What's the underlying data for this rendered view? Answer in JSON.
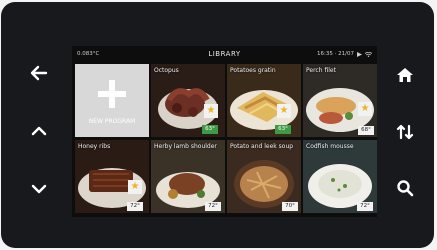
{
  "status": {
    "left": "0.083°C",
    "title": "LIBRARY",
    "right": "16:35 · 21/07"
  },
  "new_program": {
    "label": "NEW PROGRAM"
  },
  "tiles": [
    {
      "label": "Octopus",
      "temp": "63°",
      "icon": "star-icon"
    },
    {
      "label": "Potatoes gratin",
      "temp": "63°",
      "icon": "star-icon"
    },
    {
      "label": "Perch filet",
      "temp": "68°",
      "icon": "star-icon"
    },
    {
      "label": "Honey ribs",
      "temp": "72°",
      "icon": "star-icon"
    },
    {
      "label": "Herby lamb shoulder",
      "temp": "72°",
      "icon": "star-icon"
    },
    {
      "label": "Potato and leek soup",
      "temp": "70°",
      "icon": "star-icon"
    },
    {
      "label": "Codfish mousse",
      "temp": "72°",
      "icon": "star-icon"
    }
  ],
  "nav": {
    "left": [
      "back-arrow-icon",
      "chevron-up-icon",
      "chevron-down-icon"
    ],
    "right": [
      "home-icon",
      "sort-icon",
      "search-icon"
    ]
  },
  "colors": {
    "bezel": "#17191c",
    "star": "#f0b323",
    "temp_green": "#3e9b45",
    "new_program_bg": "#d8d8d8"
  }
}
